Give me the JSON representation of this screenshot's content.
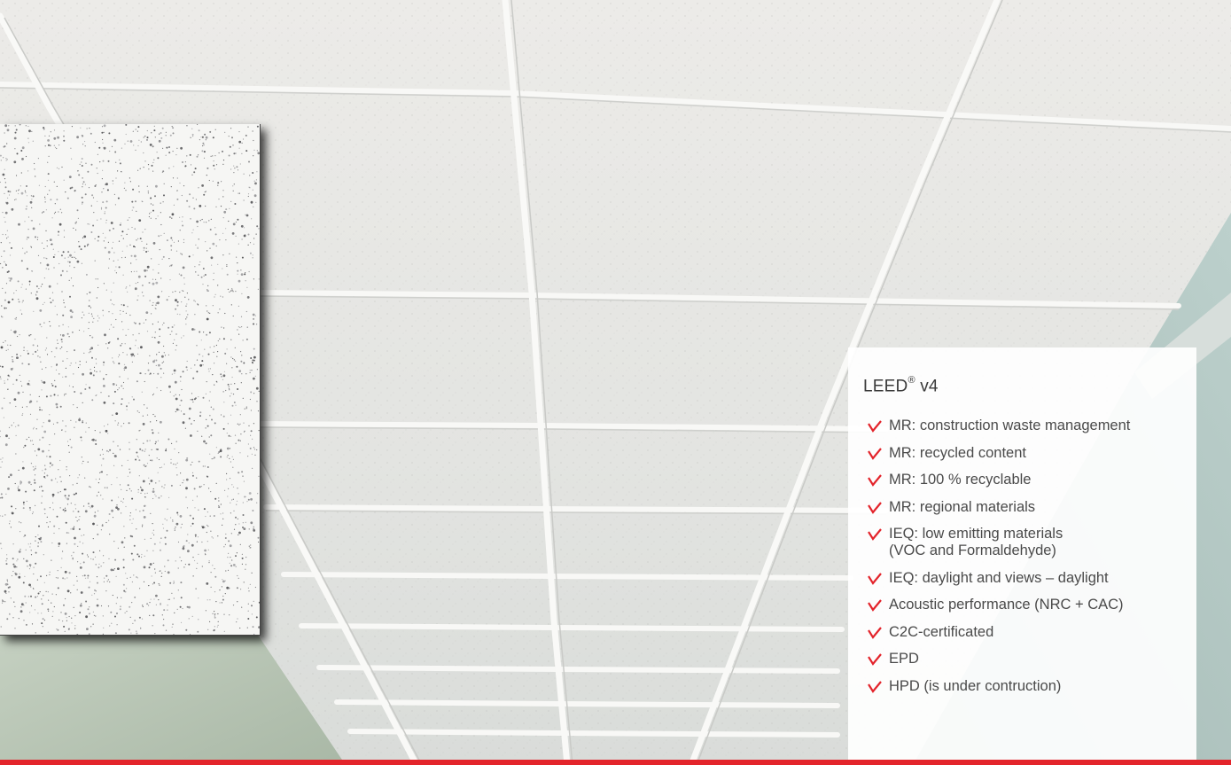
{
  "panel": {
    "title": "LEED",
    "title_mark": "®",
    "title_version": " v4",
    "items": [
      {
        "text": "MR: construction waste management"
      },
      {
        "text": "MR: recycled content"
      },
      {
        "text": "MR: 100 % recyclable"
      },
      {
        "text": "MR: regional materials"
      },
      {
        "text": "IEQ: low emitting materials",
        "text2": "(VOC and Formaldehyde)"
      },
      {
        "text": "IEQ: daylight and views – daylight"
      },
      {
        "text": "Acoustic performance (NRC + CAC)"
      },
      {
        "text": "C2C-certificated"
      },
      {
        "text": "EPD"
      },
      {
        "text": "HPD (is under contruction)"
      }
    ]
  },
  "colors": {
    "accent": "#e3242b",
    "ceiling": "#e9e9e6",
    "grid": "#f7f7f5",
    "wall": "#b9c9b9"
  },
  "icons": [
    "down-right-arrow-icon"
  ]
}
